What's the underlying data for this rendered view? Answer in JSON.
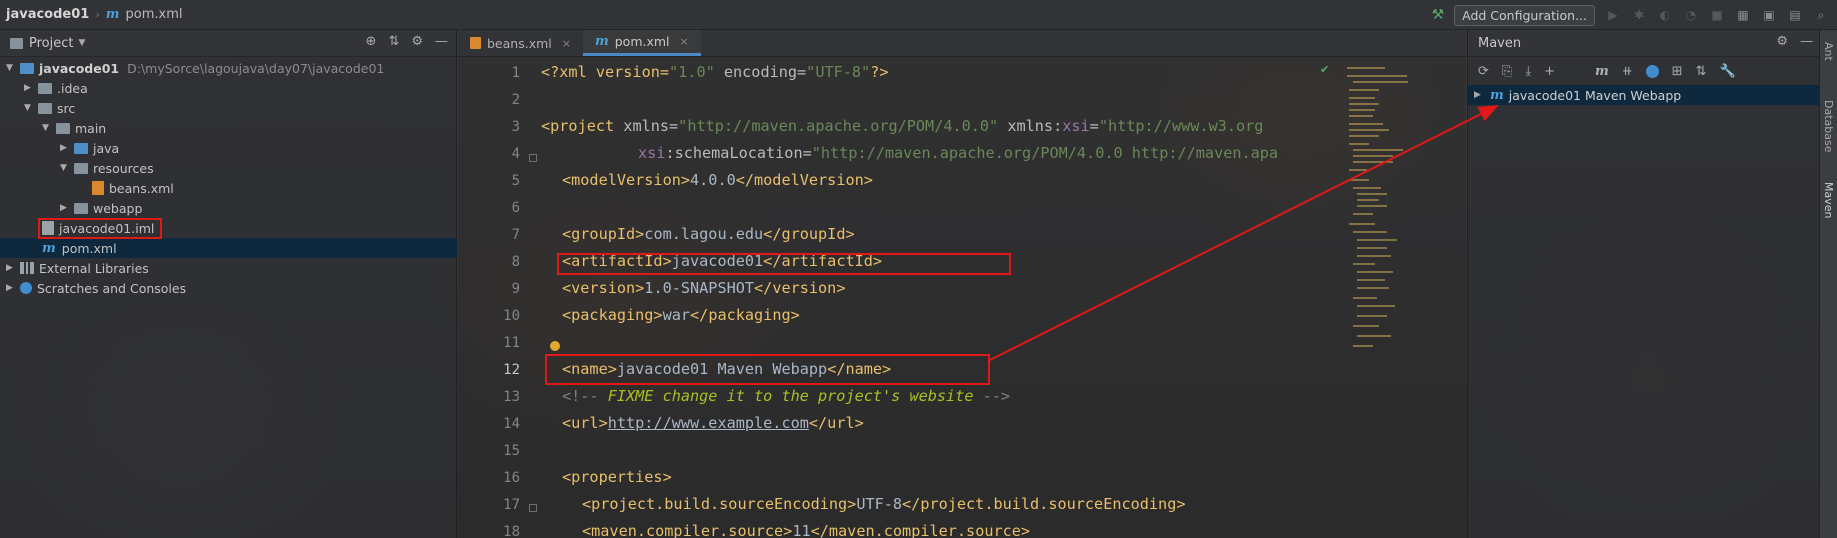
{
  "titlebar": {
    "project": "javacode01",
    "file": "pom.xml",
    "add_configuration": "Add Configuration..."
  },
  "project_panel": {
    "title": "Project",
    "tree": [
      {
        "label": "javacode01",
        "path": "D:\\mySorce\\lagoujava\\day07\\javacode01"
      },
      {
        "label": ".idea"
      },
      {
        "label": "src"
      },
      {
        "label": "main"
      },
      {
        "label": "java"
      },
      {
        "label": "resources"
      },
      {
        "label": "beans.xml"
      },
      {
        "label": "webapp"
      },
      {
        "label": "javacode01.iml"
      },
      {
        "label": "pom.xml"
      },
      {
        "label": "External Libraries"
      },
      {
        "label": "Scratches and Consoles"
      }
    ]
  },
  "editor": {
    "tabs": [
      {
        "label": "beans.xml"
      },
      {
        "label": "pom.xml"
      }
    ],
    "line_numbers": [
      "1",
      "2",
      "3",
      "4",
      "5",
      "6",
      "7",
      "8",
      "9",
      "10",
      "11",
      "12",
      "13",
      "14",
      "15",
      "16",
      "17",
      "18"
    ],
    "lines": {
      "l1": {
        "a": "<?xml version=",
        "b": "\"1.0\"",
        "c": " encoding=",
        "d": "\"UTF-8\"",
        "e": "?>"
      },
      "l3": {
        "a": "<project ",
        "b": "xmlns=",
        "c": "\"http://maven.apache.org/POM/4.0.0\"",
        "d": " xmlns:",
        "e": "xsi",
        "f": "=",
        "g": "\"http://www.w3.org"
      },
      "l4": {
        "a": "xsi",
        "b": ":schemaLocation=",
        "c": "\"http://maven.apache.org/POM/4.0.0 http://maven.apa"
      },
      "l5": {
        "open": "<modelVersion>",
        "text": "4.0.0",
        "close": "</modelVersion>"
      },
      "l7": {
        "open": "<groupId>",
        "text": "com.lagou.edu",
        "close": "</groupId>"
      },
      "l8": {
        "open": "<artifactId>",
        "text": "javacode01",
        "close": "</artifactId>"
      },
      "l9": {
        "open": "<version>",
        "text": "1.0-SNAPSHOT",
        "close": "</version>"
      },
      "l10": {
        "open": "<packaging>",
        "text": "war",
        "close": "</packaging>"
      },
      "l12": {
        "open": "<name>",
        "text": "javacode01 Maven Webapp",
        "close": "</name>"
      },
      "l13": {
        "open": "<!-- ",
        "todo": "FIXME change it to the project's website",
        "close": " -->"
      },
      "l14": {
        "open": "<url>",
        "text": "http://www.example.com",
        "close": "</url>"
      },
      "l16": {
        "open": "<properties>"
      },
      "l17": {
        "open": "<project.build.sourceEncoding>",
        "text": "UTF-8",
        "close": "</project.build.sourceEncoding>"
      },
      "l18": {
        "open": "<maven.compiler.source>",
        "text": "11",
        "close": "</maven.compiler.source>"
      }
    }
  },
  "maven_panel": {
    "title": "Maven",
    "project_item": "javacode01 Maven Webapp"
  },
  "right_stripe": {
    "tabs": [
      "Ant",
      "Database",
      "Maven"
    ]
  },
  "colors": {
    "annotation": "#e01818",
    "selection": "#0d293e",
    "accent": "#4a88c7"
  }
}
